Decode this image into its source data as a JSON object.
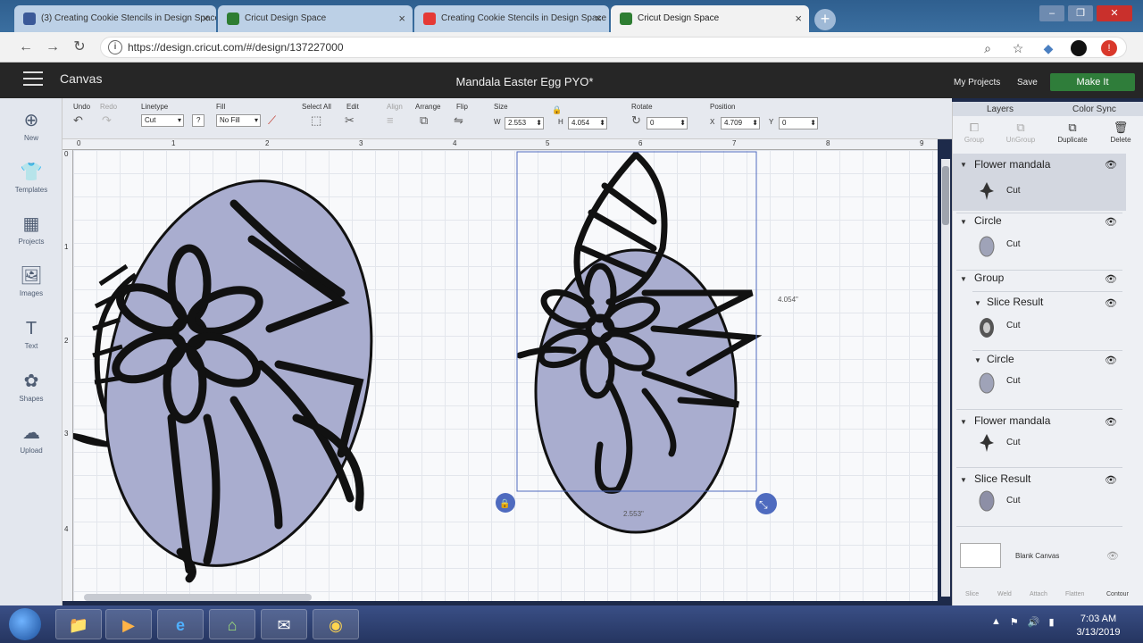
{
  "browser": {
    "tabs": [
      {
        "title": "(3) Creating Cookie Stencils in Design Space",
        "favicon_color": "#3b5998",
        "active": false
      },
      {
        "title": "Cricut Design Space",
        "favicon_color": "#2e7d32",
        "active": false
      },
      {
        "title": "Creating Cookie Stencils in Design Space",
        "favicon_color": "#e53935",
        "active": false
      },
      {
        "title": "Cricut Design Space",
        "favicon_color": "#2e7d32",
        "active": true
      }
    ],
    "close_glyph": "×",
    "new_tab_glyph": "+",
    "window_buttons": [
      "‒",
      "❐",
      "✕"
    ],
    "back_glyph": "←",
    "forward_glyph": "→",
    "reload_glyph": "↻",
    "info_glyph": "i",
    "url": "https://design.cricut.com/#/design/137227000",
    "omni_icons": {
      "zoom": "⌕",
      "star": "☆",
      "ext": "◆",
      "alert": "!"
    }
  },
  "app": {
    "menu_label": "Canvas",
    "document_title": "Mandala Easter Egg PYO*",
    "my_projects": "My Projects",
    "save": "Save",
    "make_it": "Make It",
    "accent": "#2f7d3a"
  },
  "left_tools": [
    {
      "label": "New",
      "glyph": "⊕"
    },
    {
      "label": "Templates",
      "glyph": "👕"
    },
    {
      "label": "Projects",
      "glyph": "▦"
    },
    {
      "label": "Images",
      "glyph": "🖼"
    },
    {
      "label": "Text",
      "glyph": "T"
    },
    {
      "label": "Shapes",
      "glyph": "✿"
    },
    {
      "label": "Upload",
      "glyph": "☁"
    }
  ],
  "toolbar": {
    "undo": "Undo",
    "redo": "Redo",
    "undo_glyph": "↶",
    "redo_glyph": "↷",
    "linetype_label": "Linetype",
    "linetype_value": "Cut",
    "linetype_help": "?",
    "fill_label": "Fill",
    "fill_value": "No Fill",
    "fill_glyph": "⟋",
    "select_all": "Select All",
    "select_all_glyph": "⬚",
    "edit": "Edit",
    "edit_glyph": "✂",
    "align": "Align",
    "align_glyph": "≡",
    "arrange": "Arrange",
    "arrange_glyph": "⧉",
    "flip": "Flip",
    "flip_glyph": "⇋",
    "size_label": "Size",
    "lock_glyph": "🔒",
    "w_label": "W",
    "w_value": "2.553",
    "h_label": "H",
    "h_value": "4.054",
    "rotate_label": "Rotate",
    "rotate_glyph": "↻",
    "rotate_value": "0",
    "position_label": "Position",
    "x_label": "X",
    "x_value": "4.709",
    "y_label": "Y",
    "y_value": "0",
    "spin_glyph": "⬍",
    "dropdown_glyph": "▾"
  },
  "ruler": {
    "top_ticks": [
      "0",
      "1",
      "2",
      "3",
      "4",
      "5",
      "6",
      "7",
      "8",
      "9"
    ],
    "left_ticks": [
      "0",
      "1",
      "2",
      "3",
      "4"
    ]
  },
  "canvas": {
    "height_readout": "4.054\"",
    "width_readout": "2.553\"",
    "lock_glyph": "🔒",
    "resize_glyph": "⤡"
  },
  "layers_panel": {
    "tab_layers": "Layers",
    "tab_color_sync": "Color Sync",
    "actions": [
      {
        "label": "Group",
        "glyph": "⧠",
        "enabled": false
      },
      {
        "label": "UnGroup",
        "glyph": "⧉",
        "enabled": false
      },
      {
        "label": "Duplicate",
        "glyph": "⧉",
        "enabled": true
      },
      {
        "label": "Delete",
        "glyph": "🗑",
        "enabled": true
      }
    ],
    "expand_glyph": "▼",
    "eye_glyph": "👁",
    "layers": [
      {
        "name": "Flower mandala",
        "op": "Cut",
        "thumb": "mandala",
        "selected": true
      },
      {
        "name": "Circle",
        "op": "Cut",
        "thumb": "oval"
      },
      {
        "name": "Group"
      },
      {
        "name": "Slice Result",
        "op": "Cut",
        "thumb": "mandala"
      },
      {
        "name": "Circle",
        "op": "Cut",
        "thumb": "oval"
      },
      {
        "name": "Flower mandala",
        "op": "Cut",
        "thumb": "mandala"
      },
      {
        "name": "Slice Result",
        "op": "Cut",
        "thumb": "oval"
      }
    ],
    "blank_canvas": "Blank Canvas",
    "bottom_actions": [
      "Slice",
      "Weld",
      "Attach",
      "Flatten",
      "Contour"
    ]
  },
  "taskbar": {
    "apps": [
      {
        "name": "explorer",
        "glyph": "📁"
      },
      {
        "name": "media",
        "glyph": "▶"
      },
      {
        "name": "ie",
        "glyph": "e"
      },
      {
        "name": "hp",
        "glyph": "⌂"
      },
      {
        "name": "mail",
        "glyph": "✉"
      },
      {
        "name": "chrome",
        "glyph": "◉"
      }
    ],
    "tray_glyphs": [
      "▲",
      "⚑",
      "🔊",
      "▮"
    ],
    "time": "7:03 AM",
    "date": "3/13/2019"
  }
}
